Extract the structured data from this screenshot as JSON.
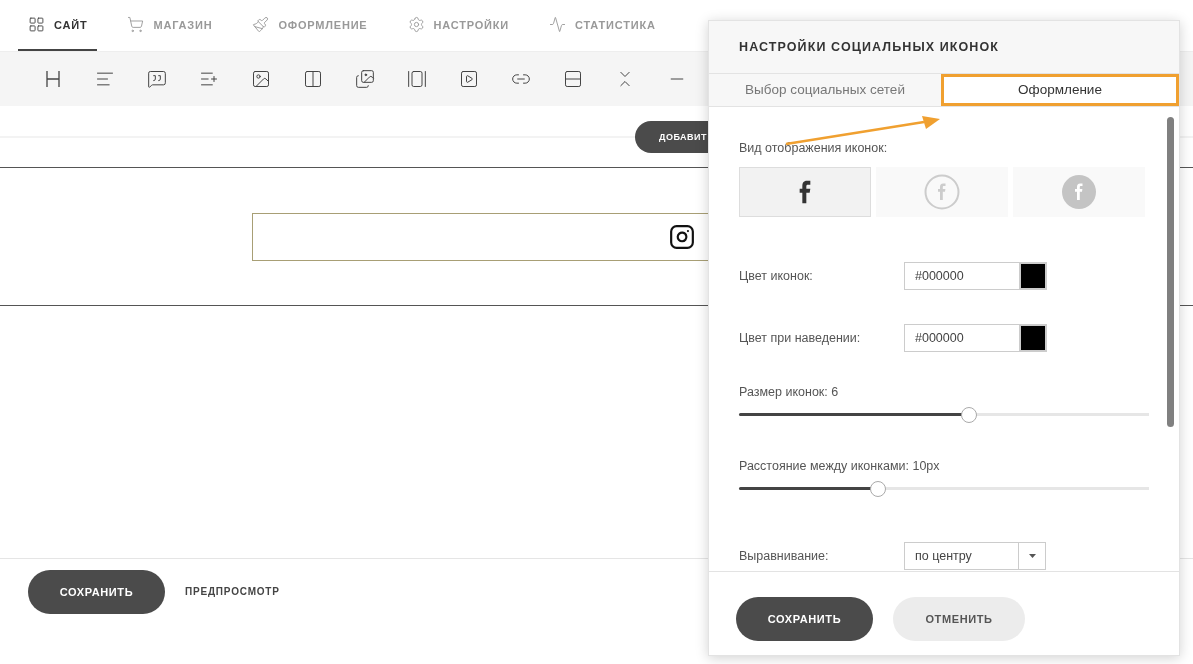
{
  "nav": {
    "tabs": [
      {
        "label": "САЙТ",
        "selected": true
      },
      {
        "label": "МАГАЗИН",
        "selected": false
      },
      {
        "label": "ОФОРМЛЕНИЕ",
        "selected": false
      },
      {
        "label": "НАСТРОЙКИ",
        "selected": false
      },
      {
        "label": "СТАТИСТИКА",
        "selected": false
      }
    ]
  },
  "add_button": {
    "label": "ДОБАВИТ"
  },
  "footer": {
    "save_button": "СОХРАНИТЬ",
    "preview_link": "ПРЕДПРОСМОТР"
  },
  "dialog": {
    "title": "НАСТРОЙКИ СОЦИАЛЬНЫХ ИКОНОК",
    "tabs": [
      {
        "label": "Выбор социальных сетей",
        "selected": false
      },
      {
        "label": "Оформление",
        "selected": true
      }
    ],
    "icon_style": {
      "label": "Вид отображения иконок:",
      "options": [
        {
          "kind": "plain",
          "selected": true
        },
        {
          "kind": "outline",
          "selected": false
        },
        {
          "kind": "filled",
          "selected": false
        }
      ]
    },
    "fields": [
      {
        "kind": "color",
        "label": "Цвет иконок:",
        "value": "#000000"
      },
      {
        "kind": "color",
        "label": "Цвет при наведении:",
        "value": "#000000"
      },
      {
        "kind": "slider",
        "label": "Размер иконок: 6",
        "level": 0.56
      },
      {
        "kind": "slider",
        "label": "Расстояние между иконками: 10px",
        "level": 0.34
      },
      {
        "kind": "select",
        "label": "Выравнивание:",
        "value": "по центру"
      }
    ],
    "buttons": {
      "save": "СОХРАНИТЬ",
      "cancel": "ОТМЕНИТЬ"
    }
  }
}
